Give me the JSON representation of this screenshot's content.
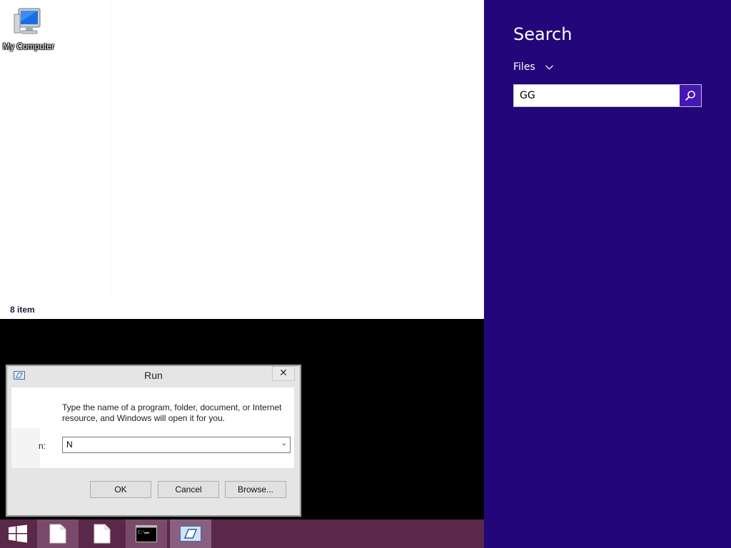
{
  "desktop": {
    "icons": [
      {
        "label": "My Computer",
        "icon": "computer-icon"
      }
    ],
    "status_item_count": "8 item"
  },
  "run_dialog": {
    "title": "Run",
    "description": "Type the name of a program, folder, document, or Internet resource, and Windows will open it for you.",
    "open_label": "n:",
    "input_value": "N",
    "close_symbol": "✕",
    "buttons": {
      "ok": "OK",
      "cancel": "Cancel",
      "browse": "Browse..."
    }
  },
  "taskbar": {
    "items": [
      {
        "name": "start",
        "icon": "windows-logo-icon"
      },
      {
        "name": "file1",
        "icon": "document-icon"
      },
      {
        "name": "file2",
        "icon": "document-icon"
      },
      {
        "name": "cmd",
        "icon": "command-prompt-icon"
      },
      {
        "name": "run",
        "icon": "run-icon"
      }
    ],
    "color": "#5a2848"
  },
  "search_pane": {
    "title": "Search",
    "scope": "Files",
    "query": "GG",
    "color": "#22067a",
    "button_color": "#4617b4"
  }
}
